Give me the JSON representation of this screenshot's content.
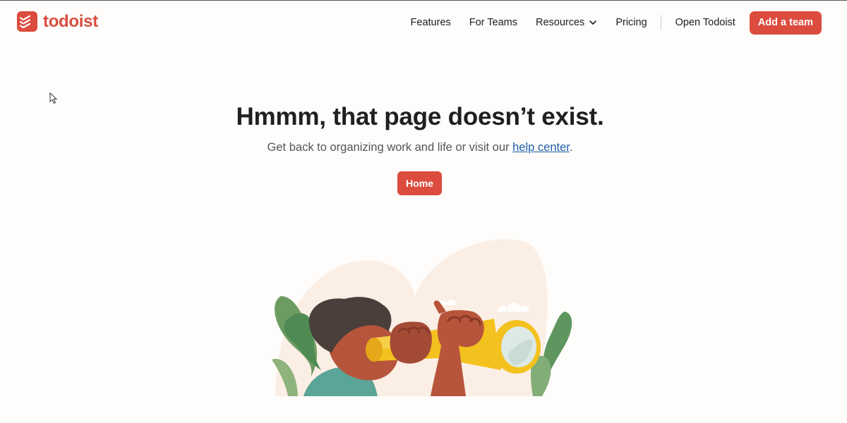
{
  "header": {
    "logo_text": "todoist",
    "nav_items": [
      {
        "label": "Features"
      },
      {
        "label": "For Teams"
      },
      {
        "label": "Resources",
        "icon": "chevron-down-icon"
      },
      {
        "label": "Pricing"
      },
      {
        "label": "Open Todoist"
      }
    ],
    "cta_label": "Add a team"
  },
  "main": {
    "heading": "Hmmm, that page doesn’t exist.",
    "subtext_before": "Get back to organizing work and life or visit our ",
    "help_link": "help center",
    "subtext_after": ".",
    "home_button": "Home"
  },
  "colors": {
    "brand_red": "#dc4c3e",
    "background": "#fefdfb",
    "link": "#1f5ea8"
  }
}
